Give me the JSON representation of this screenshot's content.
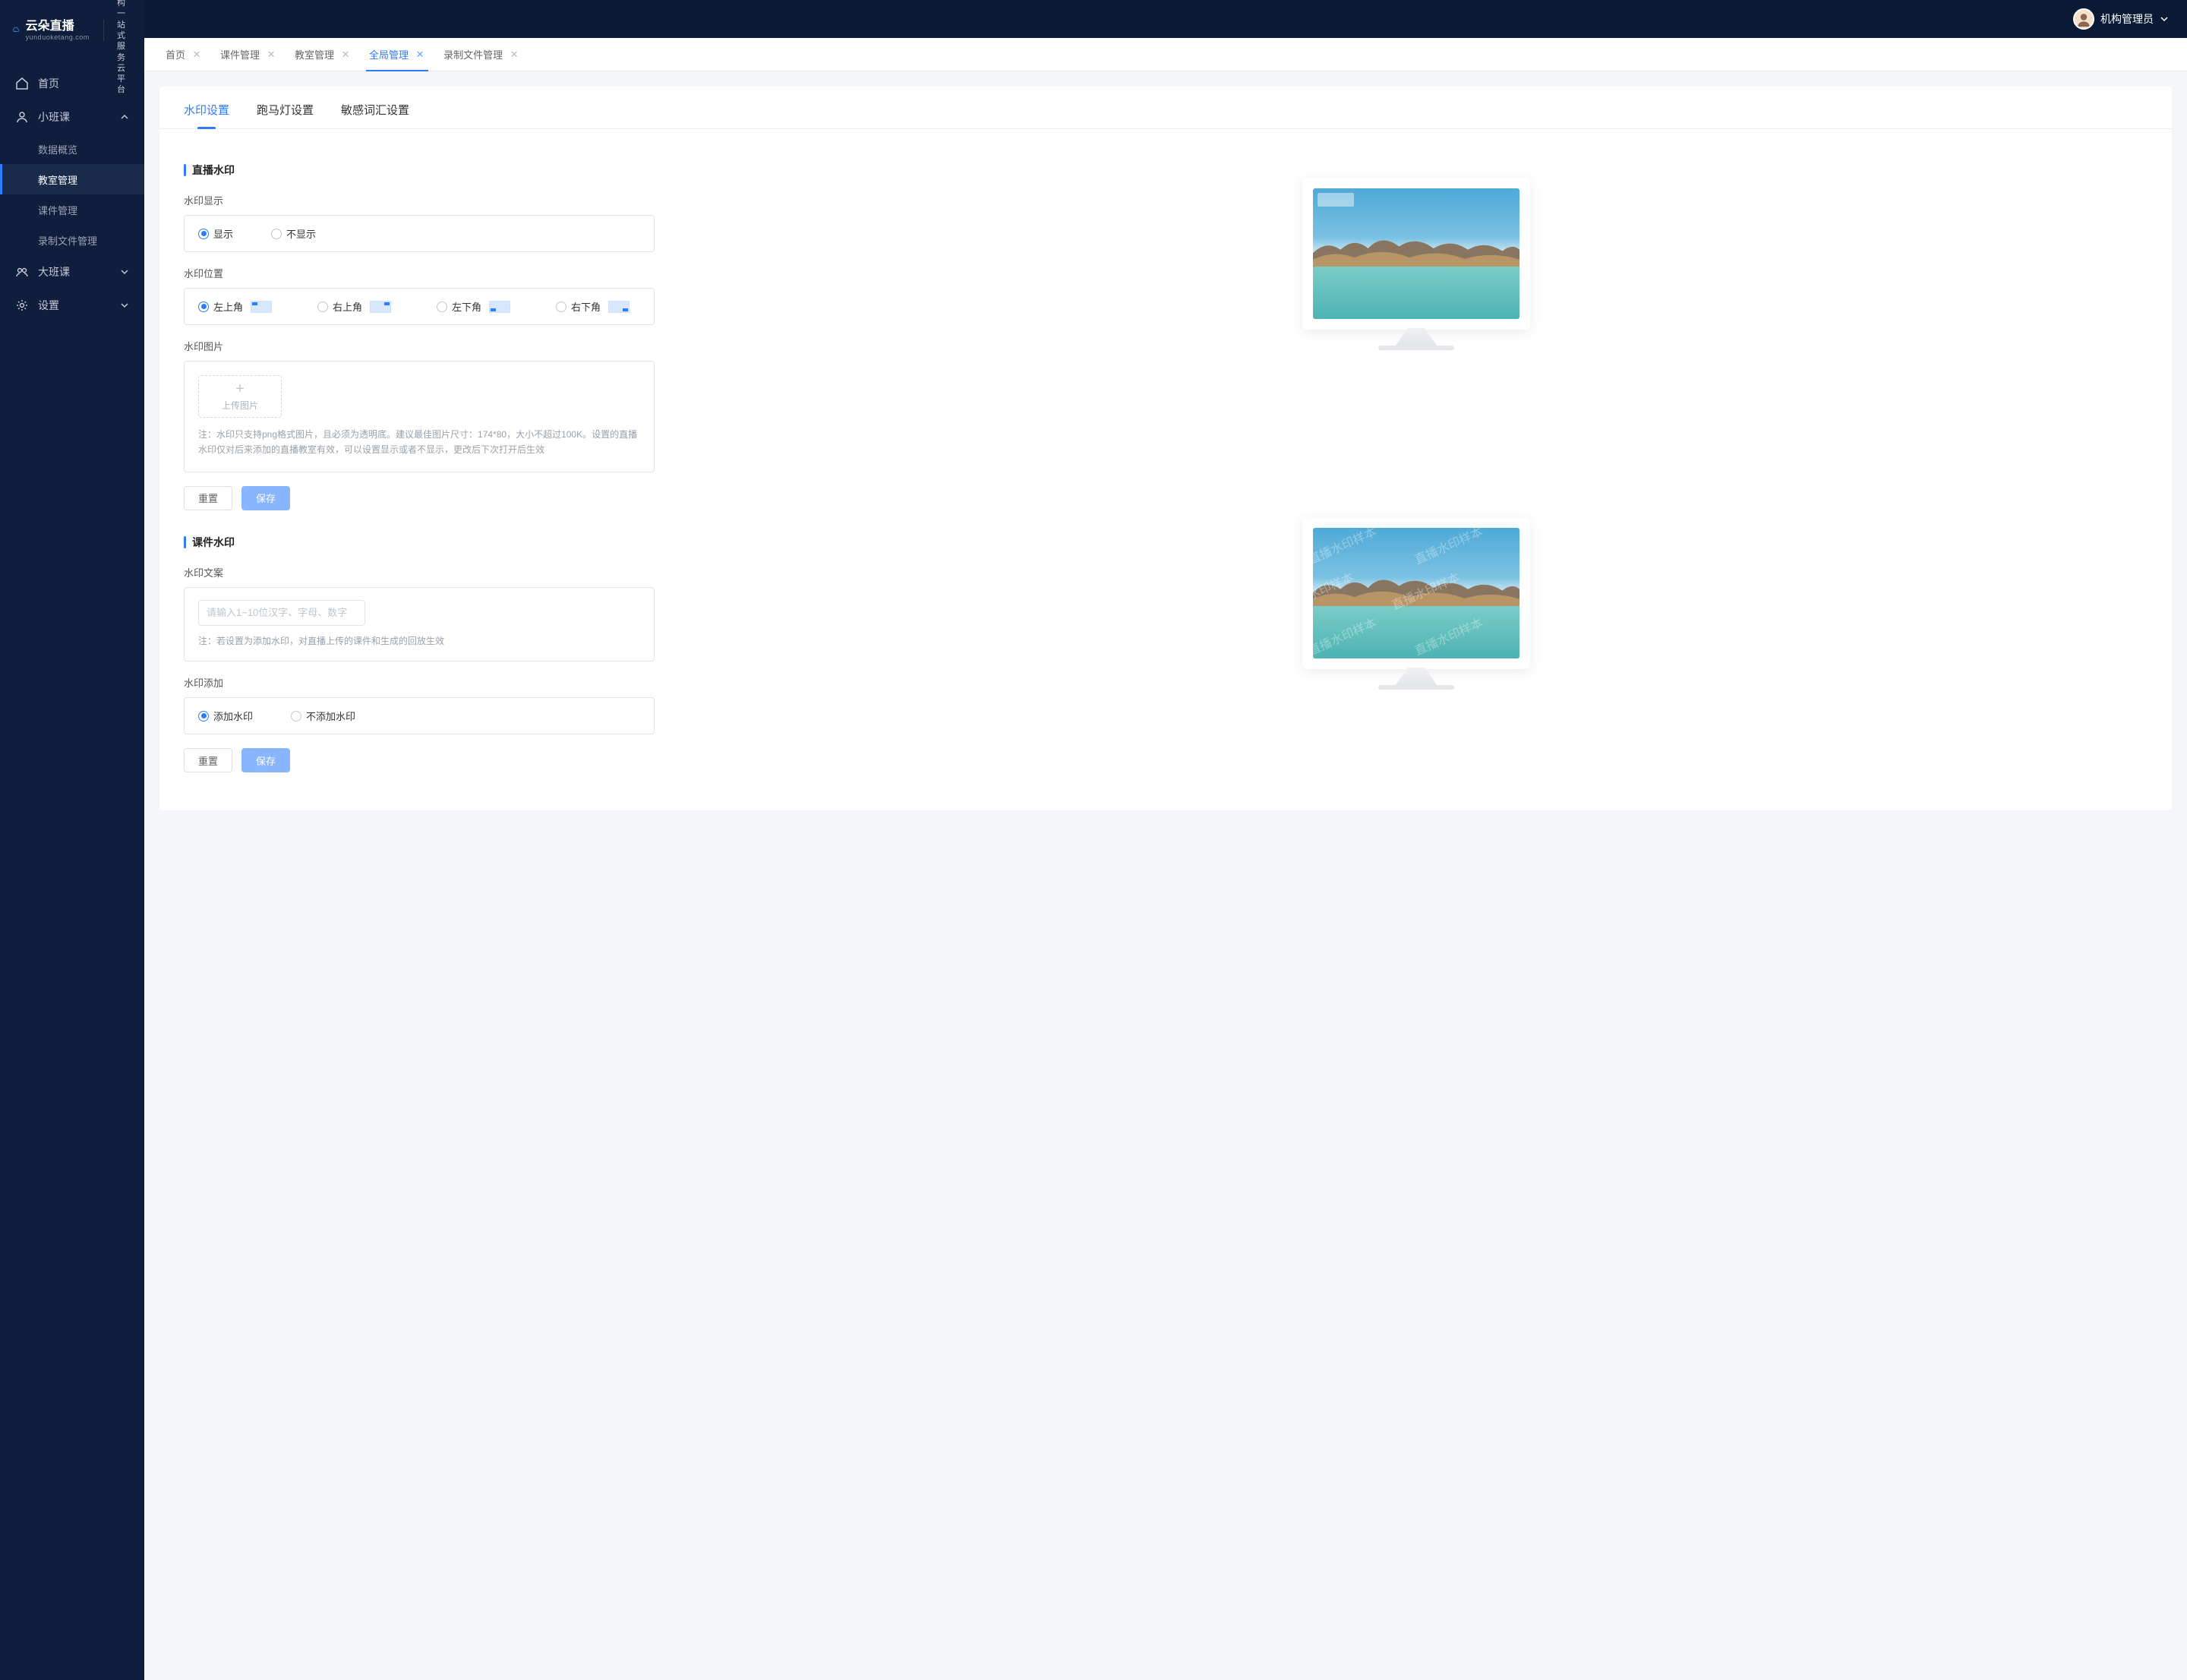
{
  "brand": {
    "name": "云朵直播",
    "domain": "yunduoketang.com",
    "tagline_line1": "教育机构一站",
    "tagline_line2": "式服务云平台"
  },
  "user": {
    "name": "机构管理员"
  },
  "nav": {
    "home": "首页",
    "small_class": "小班课",
    "small_sub": {
      "data_overview": "数据概览",
      "classroom_mgmt": "教室管理",
      "courseware_mgmt": "课件管理",
      "recording_mgmt": "录制文件管理"
    },
    "big_class": "大班课",
    "settings": "设置"
  },
  "tabs": {
    "items": [
      {
        "label": "首页"
      },
      {
        "label": "课件管理"
      },
      {
        "label": "教室管理"
      },
      {
        "label": "全局管理"
      },
      {
        "label": "录制文件管理"
      }
    ]
  },
  "inner_tabs": {
    "watermark": "水印设置",
    "marquee": "跑马灯设置",
    "sensitive": "敏感词汇设置"
  },
  "section1": {
    "title": "直播水印",
    "display_label": "水印显示",
    "display_show": "显示",
    "display_hide": "不显示",
    "position_label": "水印位置",
    "pos_tl": "左上角",
    "pos_tr": "右上角",
    "pos_bl": "左下角",
    "pos_br": "右下角",
    "image_label": "水印图片",
    "upload_text": "上传图片",
    "note": "注：水印只支持png格式图片，且必须为透明底。建议最佳图片尺寸：174*80，大小不超过100K。设置的直播水印仅对后来添加的直播教室有效，可以设置显示或者不显示，更改后下次打开后生效",
    "reset": "重置",
    "save": "保存"
  },
  "section2": {
    "title": "课件水印",
    "text_label": "水印文案",
    "placeholder": "请输入1~10位汉字、字母、数字",
    "note": "注：若设置为添加水印，对直播上传的课件和生成的回放生效",
    "add_label": "水印添加",
    "add_yes": "添加水印",
    "add_no": "不添加水印",
    "reset": "重置",
    "save": "保存",
    "sample_text": "直播水印样本"
  }
}
